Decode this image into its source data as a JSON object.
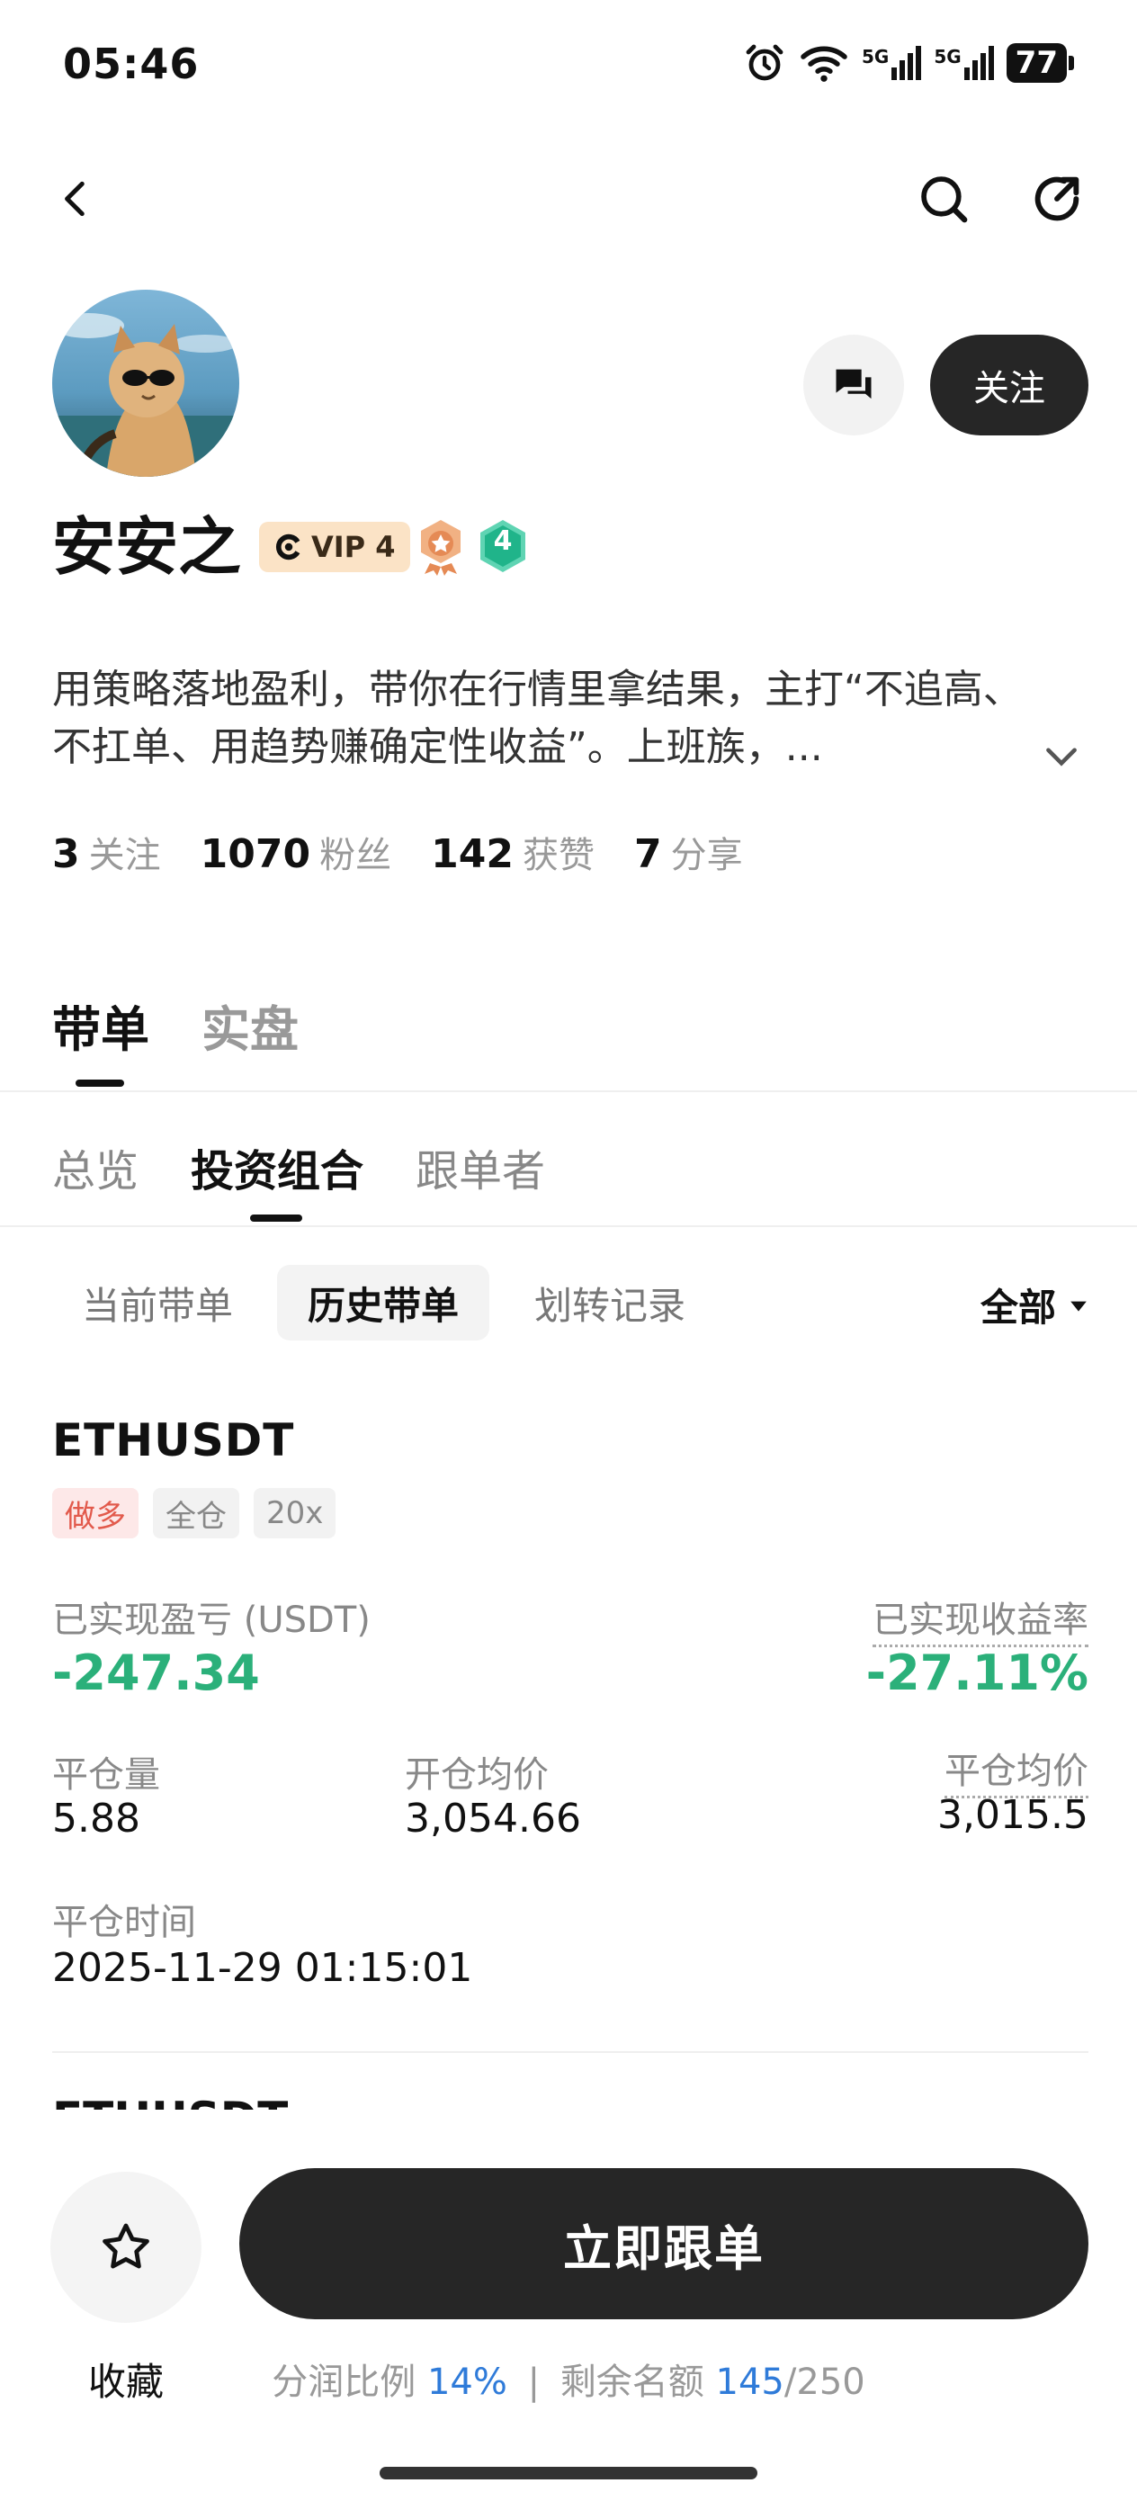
{
  "status_bar": {
    "time": "05:46",
    "network1": "5G",
    "network2": "5G",
    "battery": "77"
  },
  "profile": {
    "name": "安安之",
    "vip_label": "VIP 4",
    "level": "4",
    "bio": "用策略落地盈利，带你在行情里拿结果，主打“不追高、不扛单、用趋势赚确定性收益”。上班族，...",
    "follow_label": "关注",
    "stats": [
      {
        "num": "3",
        "label": "关注"
      },
      {
        "num": "1070",
        "label": "粉丝"
      },
      {
        "num": "142",
        "label": "获赞"
      },
      {
        "num": "7",
        "label": "分享"
      }
    ]
  },
  "main_tabs": [
    "带单",
    "实盘"
  ],
  "sub_tabs": [
    "总览",
    "投资组合",
    "跟单者"
  ],
  "filter_pills": [
    "当前带单",
    "历史带单",
    "划转记录"
  ],
  "filter_all": "全部",
  "position": {
    "symbol": "ETHUSDT",
    "tags": [
      "做多",
      "全仓",
      "20x"
    ],
    "realized_pnl_label": "已实现盈亏 (USDT)",
    "realized_pnl": "-247.34",
    "realized_roi_label": "已实现收益率",
    "realized_roi": "-27.11%",
    "close_qty_label": "平仓量",
    "close_qty": "5.88",
    "open_avg_label": "开仓均价",
    "open_avg": "3,054.66",
    "close_avg_label": "平仓均价",
    "close_avg": "3,015.5",
    "close_time_label": "平仓时间",
    "close_time": "2025-11-29 01:15:01"
  },
  "next_position_symbol": "ETHUSDT",
  "bottom": {
    "favorite_label": "收藏",
    "follow_now_label": "立即跟单",
    "profit_share_label": "分润比例",
    "profit_share_value": "14%",
    "separator": "|",
    "remaining_label": "剩余名额",
    "remaining_value": "145",
    "remaining_total": "/250"
  },
  "colors": {
    "profit_negative_green": "#2bb07a",
    "long_tag_red": "#e25a4c",
    "accent_blue": "#2f7bd9",
    "dark_button": "#262626"
  }
}
